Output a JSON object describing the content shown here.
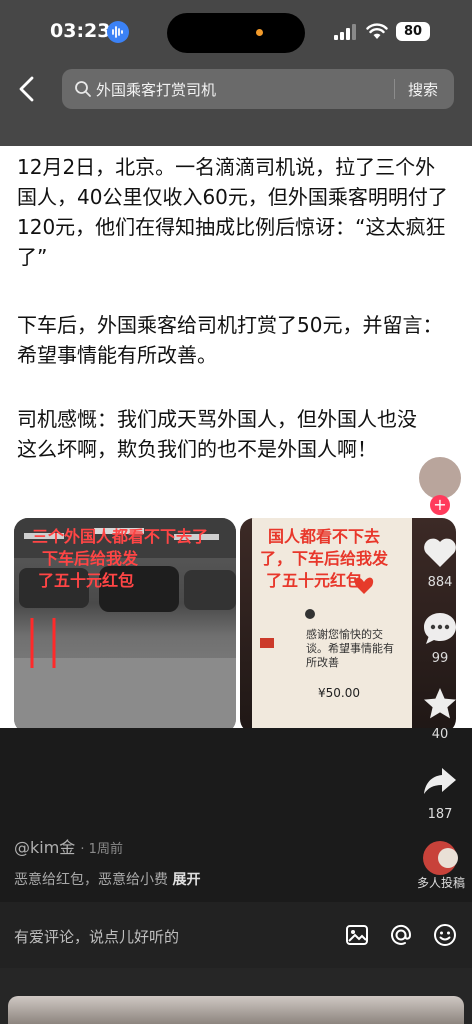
{
  "status_bar": {
    "time": "03:23",
    "battery": "80"
  },
  "search": {
    "query": "外国乘客打赏司机",
    "button": "搜索"
  },
  "article": {
    "paragraphs": [
      "12月2日，北京。一名滴滴司机说，拉了三个外国人，40公里仅收入60元，但外国乘客明明付了120元，他们在得知抽成比例后惊讶：“这太疯狂了”",
      "下车后，外国乘客给司机打赏了50元，并留言：希望事情能有所改善。",
      "司机感慨：我们成天骂外国人，但外国人也没这么坏啊，欺负我们的也不是外国人啊！"
    ],
    "image1_caption_lines": [
      "三个外国人都看不下去了",
      "下车后给我发",
      "了五十元红包"
    ],
    "image2_caption_lines": [
      "国人都看不下去",
      "了，下车后给我发",
      "了五十元红包"
    ],
    "image2_note": "感谢您愉快的交谈。希望事情能有所改善",
    "image2_amount": "¥50.00"
  },
  "actions": {
    "likes": "884",
    "comments": "99",
    "favorites": "40",
    "shares": "187"
  },
  "meta": {
    "author": "@kim金",
    "posted": "· 1周前",
    "tags": "恶意给红包，恶意给小费",
    "expand": "展开",
    "collab": "多人投稿"
  },
  "comment": {
    "placeholder": "有爱评论，说点儿好听的"
  },
  "colors": {
    "like_red": "#ff3b5c",
    "accent_blue": "#3b82f6"
  }
}
